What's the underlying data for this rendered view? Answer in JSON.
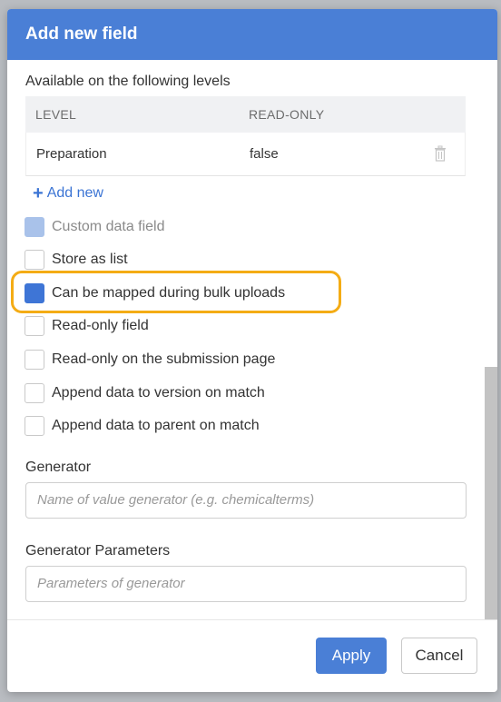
{
  "dialog": {
    "title": "Add new field",
    "levels_label": "Available on the following levels",
    "table": {
      "headers": {
        "level": "LEVEL",
        "read_only": "READ-ONLY"
      },
      "rows": [
        {
          "level": "Preparation",
          "read_only": "false"
        }
      ]
    },
    "add_new_label": "Add new",
    "options": [
      {
        "label": "Custom data field",
        "state": "checked-disabled"
      },
      {
        "label": "Store as list",
        "state": "unchecked"
      },
      {
        "label": "Can be mapped during bulk uploads",
        "state": "checked"
      },
      {
        "label": "Read-only field",
        "state": "unchecked"
      },
      {
        "label": "Read-only on the submission page",
        "state": "unchecked"
      },
      {
        "label": "Append data to version on match",
        "state": "unchecked"
      },
      {
        "label": "Append data to parent on match",
        "state": "unchecked"
      }
    ],
    "generator": {
      "label": "Generator",
      "placeholder": "Name of value generator (e.g. chemicalterms)"
    },
    "generator_params": {
      "label": "Generator Parameters",
      "placeholder": "Parameters of generator"
    },
    "buttons": {
      "apply": "Apply",
      "cancel": "Cancel"
    }
  },
  "colors": {
    "header": "#4a7fd6",
    "accent": "#3e75d6",
    "highlight": "#f4ac15"
  },
  "icons": [
    "plus-icon",
    "trash-icon"
  ]
}
